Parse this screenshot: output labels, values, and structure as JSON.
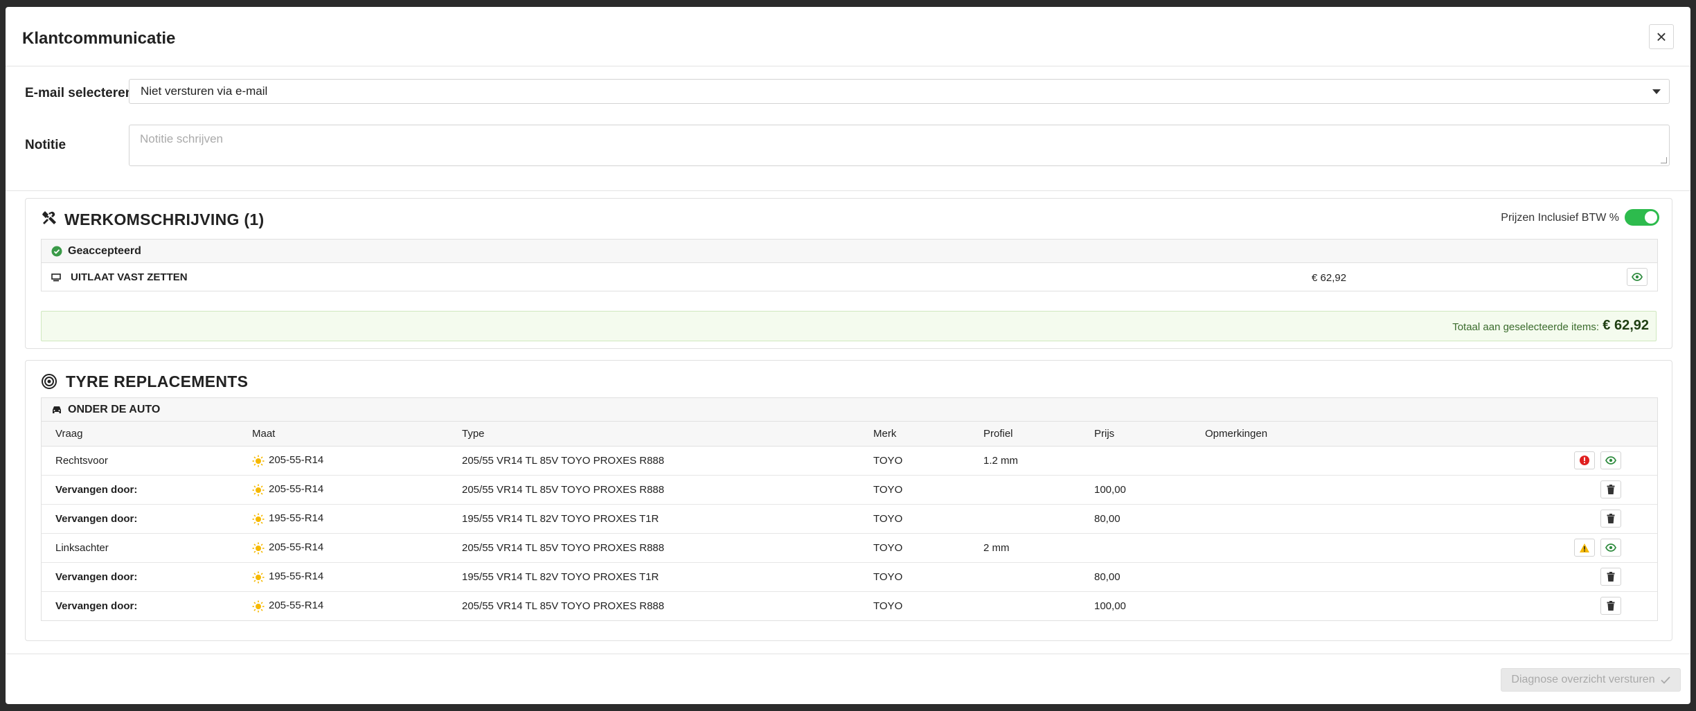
{
  "modal": {
    "title": "Klantcommunicatie"
  },
  "form": {
    "email_label": "E-mail selecteren",
    "email_required": "*",
    "email_value": "Niet versturen via e-mail",
    "note_label": "Notitie",
    "note_placeholder": "Notitie schrijven"
  },
  "work": {
    "title": "WERKOMSCHRIJVING (1)",
    "toggle_label": "Prijzen Inclusief BTW %",
    "toggle_on": true,
    "group_label": "Geaccepteerd",
    "item_label": "UITLAAT VAST ZETTEN",
    "item_price": "€ 62,92",
    "total_label": "Totaal aan geselecteerde items:",
    "total_value": "€ 62,92"
  },
  "tyres": {
    "title": "TYRE REPLACEMENTS",
    "group_label": "ONDER DE AUTO",
    "columns": [
      "Vraag",
      "Maat",
      "Type",
      "Merk",
      "Profiel",
      "Prijs",
      "Opmerkingen"
    ],
    "rows": [
      {
        "vraag": "Rechtsvoor",
        "maat": "205-55-R14",
        "type": "205/55 VR14 TL 85V TOYO PROXES R888",
        "merk": "TOYO",
        "profiel": "1.2 mm",
        "prijs": "",
        "opm": ""
      },
      {
        "vraag": "Vervangen door:",
        "maat": "205-55-R14",
        "type": "205/55 VR14 TL 85V TOYO PROXES R888",
        "merk": "TOYO",
        "profiel": "",
        "prijs": "100,00",
        "opm": ""
      },
      {
        "vraag": "Vervangen door:",
        "maat": "195-55-R14",
        "type": "195/55 VR14 TL 82V TOYO PROXES T1R",
        "merk": "TOYO",
        "profiel": "",
        "prijs": "80,00",
        "opm": ""
      },
      {
        "vraag": "Linksachter",
        "maat": "205-55-R14",
        "type": "205/55 VR14 TL 85V TOYO PROXES R888",
        "merk": "TOYO",
        "profiel": "2 mm",
        "prijs": "",
        "opm": ""
      },
      {
        "vraag": "Vervangen door:",
        "maat": "195-55-R14",
        "type": "195/55 VR14 TL 82V TOYO PROXES T1R",
        "merk": "TOYO",
        "profiel": "",
        "prijs": "80,00",
        "opm": ""
      },
      {
        "vraag": "Vervangen door:",
        "maat": "205-55-R14",
        "type": "205/55 VR14 TL 85V TOYO PROXES R888",
        "merk": "TOYO",
        "profiel": "",
        "prijs": "100,00",
        "opm": ""
      }
    ]
  },
  "footer": {
    "send_label": "Diagnose overzicht versturen"
  },
  "colors": {
    "accent_green": "#2dbb4d",
    "danger_red": "#e02020",
    "warning_yellow": "#f5b800"
  }
}
